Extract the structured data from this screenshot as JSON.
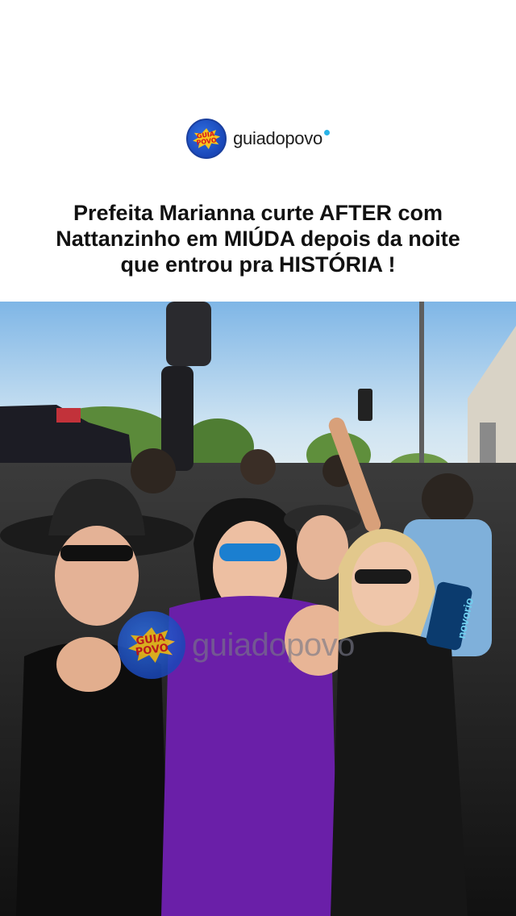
{
  "brand": {
    "logo_text_line1": "GUIA",
    "logo_text_line2": "POVO",
    "name": "guiadopovo",
    "dot_color": "#2ab4e8"
  },
  "headline": {
    "line1": "Prefeita Marianna curte AFTER com",
    "line2": "Nattanzinho em MIÚDA depois da noite",
    "line3": "que entrou pra HISTÓRIA !"
  },
  "photo": {
    "watermark_text": "guiadopovo",
    "watermark_logo_line1": "GUIA",
    "watermark_logo_line2": "POVO",
    "can_label": "novorio"
  },
  "colors": {
    "logo_blue": "#1a47b8",
    "logo_yellow": "#f7c51e",
    "logo_red": "#d4161c",
    "dress_purple": "#6a1fa8"
  }
}
